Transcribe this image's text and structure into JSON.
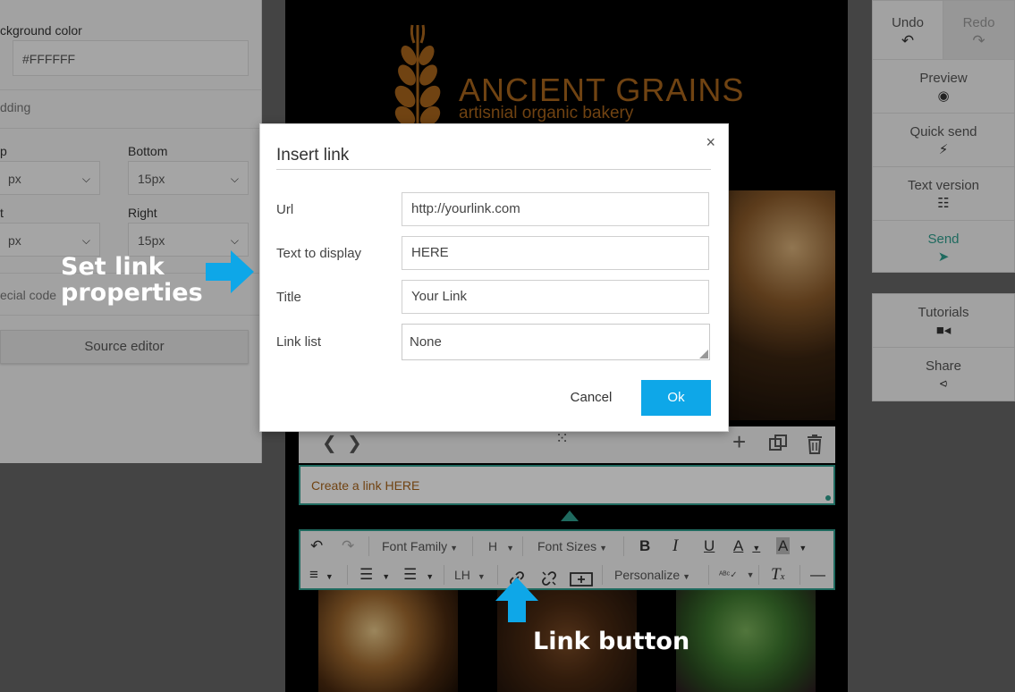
{
  "left_panel": {
    "background_color_label": "ckground color",
    "background_color_value": "#FFFFFF",
    "padding_label": "dding",
    "top_label": "p",
    "top_value": "px",
    "bottom_label": "Bottom",
    "bottom_value": "15px",
    "left_label": "t",
    "left_value": "px",
    "right_label": "Right",
    "right_value": "15px",
    "special_code_label": "ecial code",
    "source_editor_label": "Source editor"
  },
  "canvas": {
    "brand_title": "ANCIENT GRAINS",
    "brand_subtitle": "artisnial organic bakery",
    "text_block": "Create a link HERE",
    "block_toolbar": {
      "prev_icon": "chevron-left-icon",
      "next_icon": "chevron-right-icon",
      "drag_icon": "drag-handle-icon",
      "add_icon": "plus-icon",
      "duplicate_icon": "duplicate-icon",
      "delete_icon": "trash-icon"
    }
  },
  "editor_toolbar": {
    "font_family": "Font Family",
    "heading": "H",
    "font_sizes": "Font Sizes",
    "bold": "B",
    "italic": "I",
    "underline": "U",
    "text_color": "A",
    "bg_color": "A",
    "line_height": "LH",
    "personalize": "Personalize"
  },
  "right_panel": {
    "undo": "Undo",
    "redo": "Redo",
    "preview": "Preview",
    "quick_send": "Quick send",
    "text_version": "Text version",
    "send": "Send",
    "tutorials": "Tutorials",
    "share": "Share"
  },
  "modal": {
    "title": "Insert link",
    "url_label": "Url",
    "url_value": "http://yourlink.com",
    "text_label": "Text to display",
    "text_value": "HERE",
    "title_label": "Title",
    "title_value": "Your Link",
    "link_list_label": "Link list",
    "link_list_value": "None",
    "cancel": "Cancel",
    "ok": "Ok",
    "close": "×"
  },
  "annotations": {
    "set_link_line1": "Set link",
    "set_link_line2": "properties",
    "link_button": "Link button"
  },
  "colors": {
    "accent": "#2f9e8e",
    "brand": "#a8641c",
    "ok_button": "#0ea7e8",
    "arrow": "#0ea7e8"
  }
}
